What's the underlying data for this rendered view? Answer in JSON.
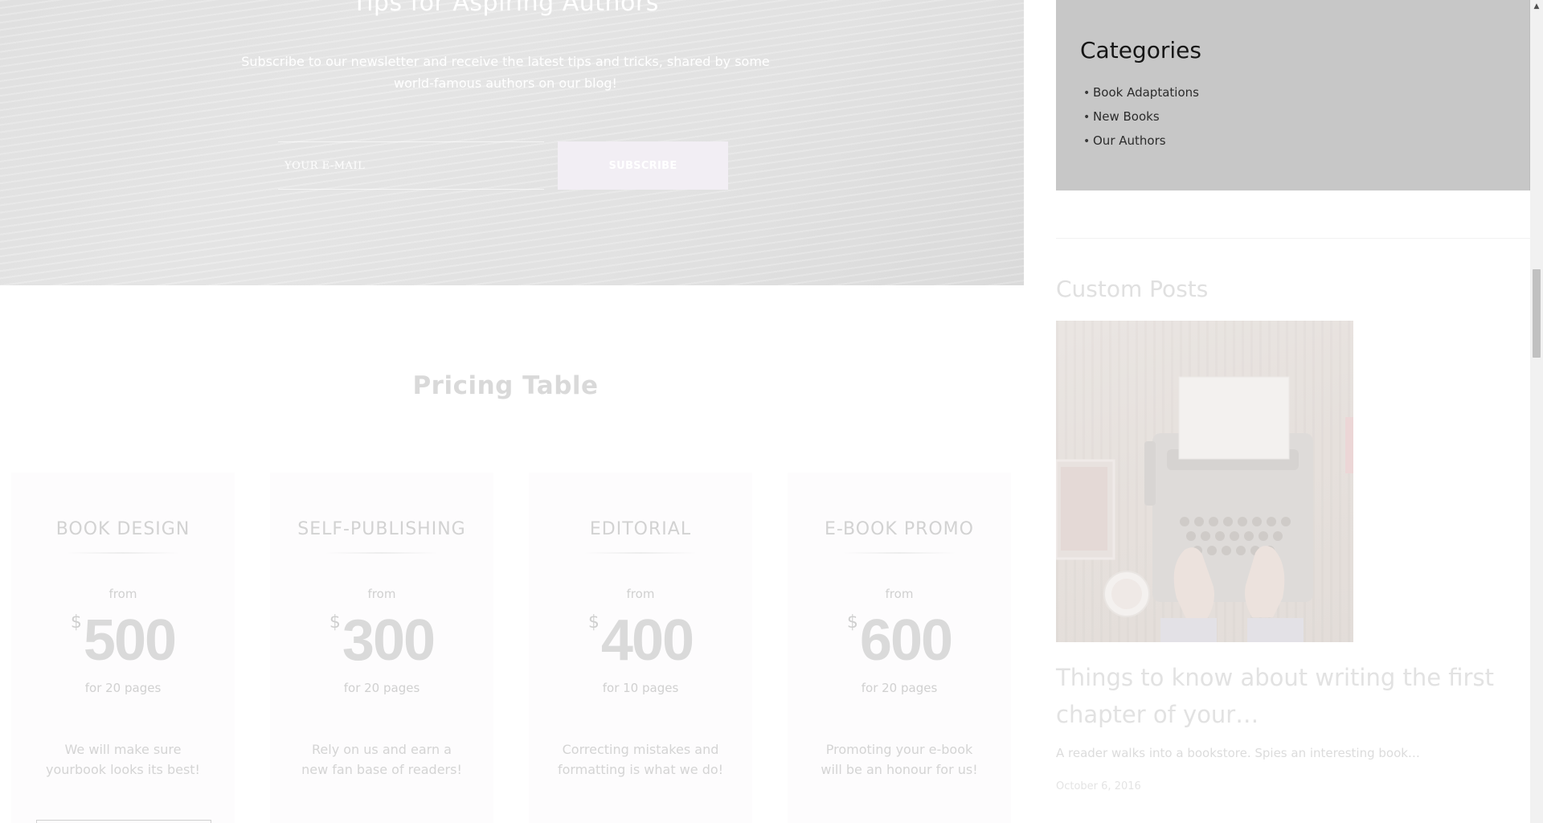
{
  "hero": {
    "title": "Tips for Aspiring Authors",
    "subtitle": "Subscribe to our newsletter and receive the latest tips and tricks, shared by some world-famous authors on our blog!",
    "email_placeholder": "YOUR E-MAIL",
    "subscribe_label": "SUBSCRIBE"
  },
  "pricing": {
    "title": "Pricing Table",
    "plans": [
      {
        "name": "BOOK DESIGN",
        "from": "from",
        "currency": "$",
        "amount": "500",
        "pages": "for 20 pages",
        "description": "We will make sure yourbook looks its best!"
      },
      {
        "name": "SELF-PUBLISHING",
        "from": "from",
        "currency": "$",
        "amount": "300",
        "pages": "for 20 pages",
        "description": "Rely on us and earn a new fan base of readers!"
      },
      {
        "name": "EDITORIAL",
        "from": "from",
        "currency": "$",
        "amount": "400",
        "pages": "for 10 pages",
        "description": "Correcting mistakes and formatting is what we do!"
      },
      {
        "name": "E-BOOK PROMO",
        "from": "from",
        "currency": "$",
        "amount": "600",
        "pages": "for 20 pages",
        "description": "Promoting your e-book will be an honour for us!"
      }
    ]
  },
  "sidebar": {
    "categories": {
      "title": "Categories",
      "items": [
        {
          "label": "Book Adaptations"
        },
        {
          "label": "New Books"
        },
        {
          "label": "Our Authors"
        }
      ]
    },
    "custom_posts": {
      "title": "Custom Posts",
      "post": {
        "title": "Things to know about writing the first chapter of your…",
        "excerpt": "A reader walks into a bookstore. Spies an interesting book…",
        "date": "October 6, 2016"
      }
    }
  },
  "scrollbar": {
    "up_arrow": "▲"
  },
  "colors": {
    "hero_text": "#ffffff",
    "categories_bg": "#c7c7c7",
    "categories_title": "#161616",
    "subscribe_bg": "#f2eef4"
  }
}
